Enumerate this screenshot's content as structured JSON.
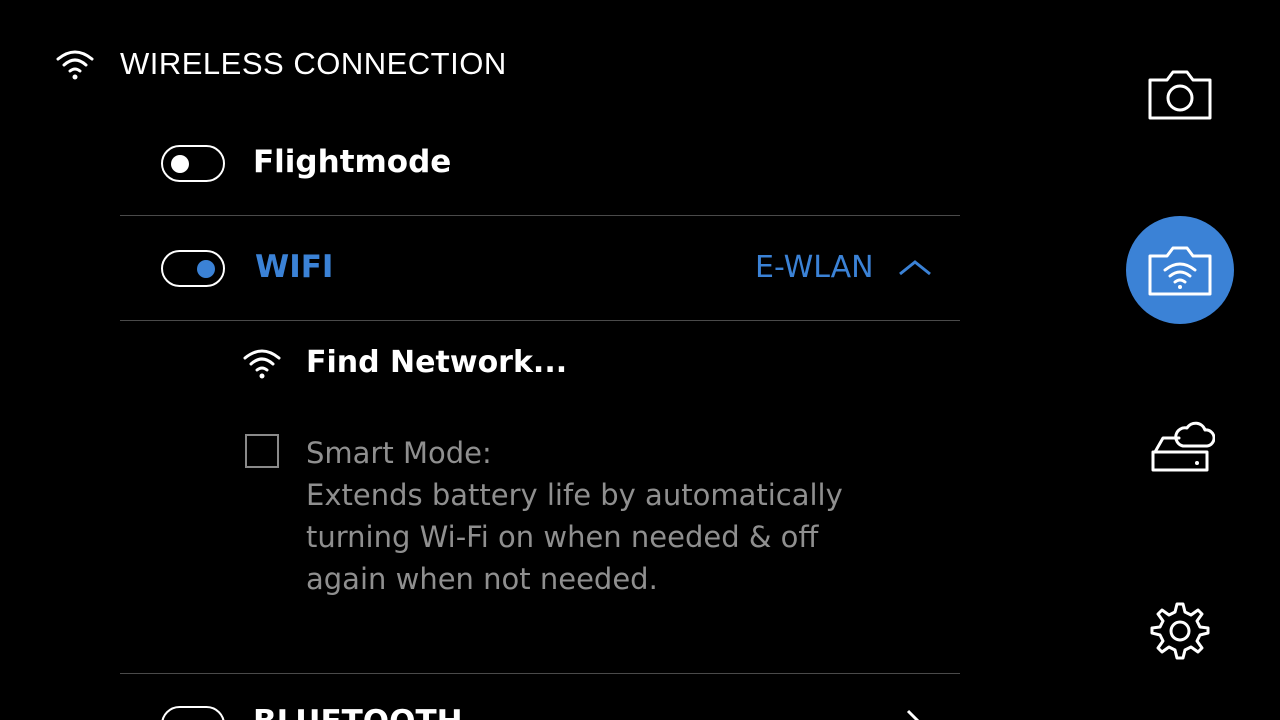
{
  "header": {
    "title": "WIRELESS CONNECTION",
    "icon": "wifi-icon"
  },
  "flightmode": {
    "label": "Flightmode",
    "on": false
  },
  "wifi": {
    "label": "WIFI",
    "on": true,
    "network": "E-WLAN",
    "expanded": true
  },
  "find_network": {
    "label": "Find Network..."
  },
  "smart_mode": {
    "checked": false,
    "lines": [
      "Smart Mode:",
      "Extends battery life by automatically",
      "turning Wi-Fi on when needed & off",
      "again when not needed."
    ]
  },
  "bluetooth": {
    "label": "BLUETOOTH",
    "on": false
  },
  "sidebar": {
    "items": [
      {
        "icon": "camera-icon",
        "active": false
      },
      {
        "icon": "camera-wifi-icon",
        "active": true
      },
      {
        "icon": "cloud-storage-icon",
        "active": false
      },
      {
        "icon": "gear-icon",
        "active": false
      }
    ]
  },
  "colors": {
    "accent": "#3b82d6",
    "muted_text": "#8f8f8f",
    "divider": "#4a4a4a"
  }
}
